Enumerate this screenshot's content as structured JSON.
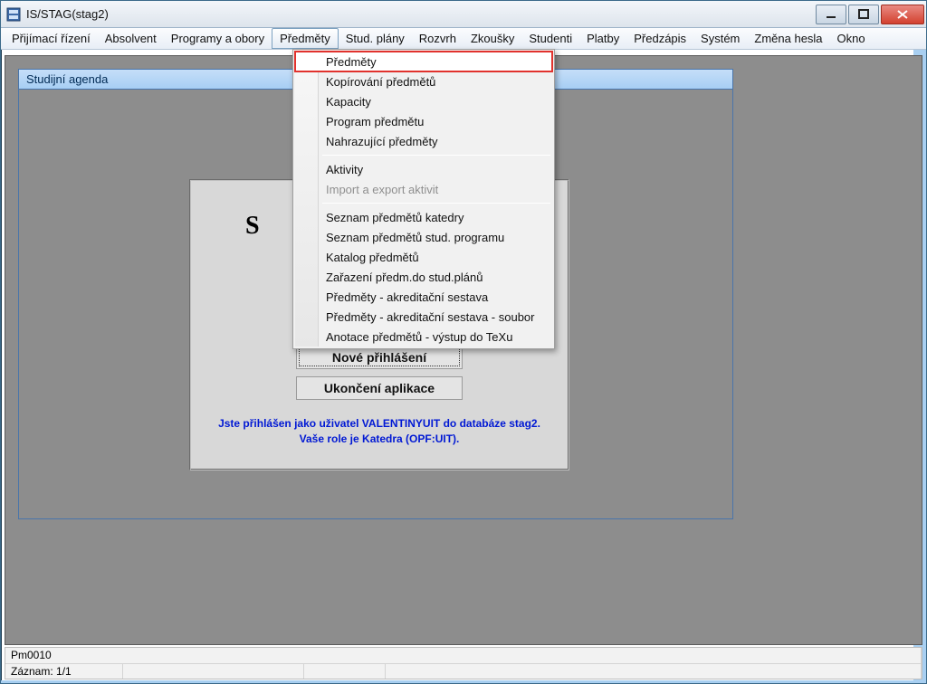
{
  "window": {
    "title": "IS/STAG(stag2)"
  },
  "menubar": {
    "items": [
      "Přijímací řízení",
      "Absolvent",
      "Programy a obory",
      "Předměty",
      "Stud. plány",
      "Rozvrh",
      "Zkoušky",
      "Studenti",
      "Platby",
      "Předzápis",
      "Systém",
      "Změna hesla",
      "Okno"
    ],
    "active_index": 3
  },
  "dropdown": {
    "groups": [
      [
        {
          "label": "Předměty",
          "highlight": true
        },
        {
          "label": "Kopírování předmětů"
        },
        {
          "label": "Kapacity"
        },
        {
          "label": "Program předmětu"
        },
        {
          "label": "Nahrazující předměty"
        }
      ],
      [
        {
          "label": "Aktivity"
        },
        {
          "label": "Import a export aktivit",
          "disabled": true
        }
      ],
      [
        {
          "label": "Seznam předmětů katedry"
        },
        {
          "label": "Seznam předmětů stud. programu"
        },
        {
          "label": "Katalog předmětů"
        },
        {
          "label": "Zařazení předm.do stud.plánů"
        },
        {
          "label": "Předměty - akreditační sestava"
        },
        {
          "label": "Předměty - akreditační sestava - soubor"
        },
        {
          "label": "Anotace předmětů - výstup do TeXu"
        }
      ]
    ]
  },
  "subwindow": {
    "title": "Studijní agenda"
  },
  "login": {
    "big_char": "S",
    "btn_new": "Nové přihlášení",
    "btn_quit": "Ukončení aplikace",
    "status": "Jste přihlášen jako uživatel VALENTINYUIT do databáze stag2. Vaše role je Katedra (OPF:UIT)."
  },
  "statusbar": {
    "line1": "Pm0010",
    "line2_label": "Záznam: 1/1"
  }
}
